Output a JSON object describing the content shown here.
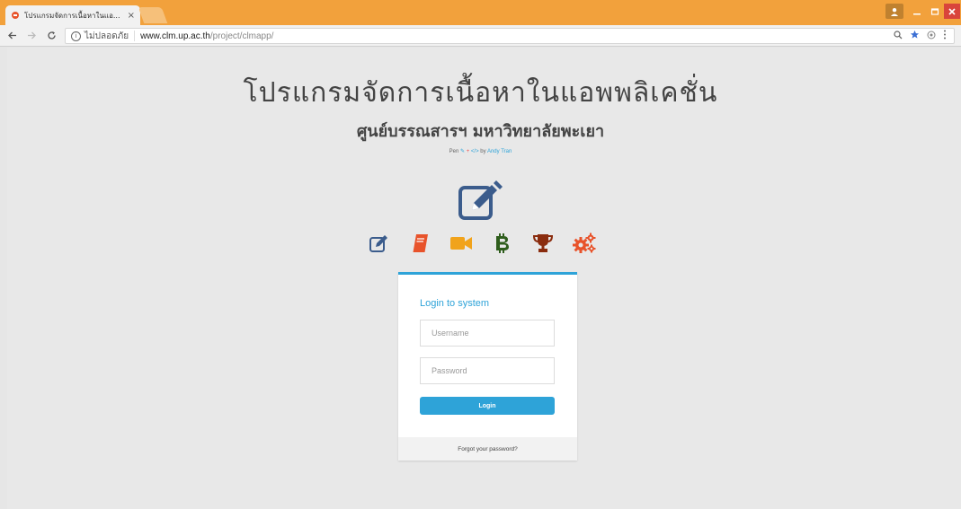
{
  "browser": {
    "tab_title": "โปรแกรมจัดการเนื้อหาในแอ...",
    "tab_close": "×",
    "security_label": "ไม่ปลอดภัย",
    "url_host": "www.clm.up.ac.th",
    "url_path": "/project/clmapp/"
  },
  "page": {
    "title": "โปรแกรมจัดการเนื้อหาในแอพพลิเคชั่น",
    "subtitle": "ศูนย์บรรณสารฯ มหาวิทยาลัยพะเยา",
    "credit": {
      "prefix": "Pen",
      "by": "by",
      "author": "Andy Tran"
    },
    "icons": [
      "edit-icon",
      "book-icon",
      "video-camera-icon",
      "bitcoin-icon",
      "trophy-icon",
      "gears-icon"
    ]
  },
  "login": {
    "title": "Login to system",
    "username_placeholder": "Username",
    "password_placeholder": "Password",
    "button_label": "Login",
    "forgot_link": "Forgot your password?"
  },
  "colors": {
    "accent": "#2ea3d8",
    "titlebar": "#f2a13c",
    "big_icon": "#3b5c8c",
    "edit": "#3b5c8c",
    "book": "#e8532b",
    "video": "#f1a31b",
    "bitcoin": "#2e5d1c",
    "trophy": "#8a2c0e",
    "gears": "#e8532b"
  }
}
